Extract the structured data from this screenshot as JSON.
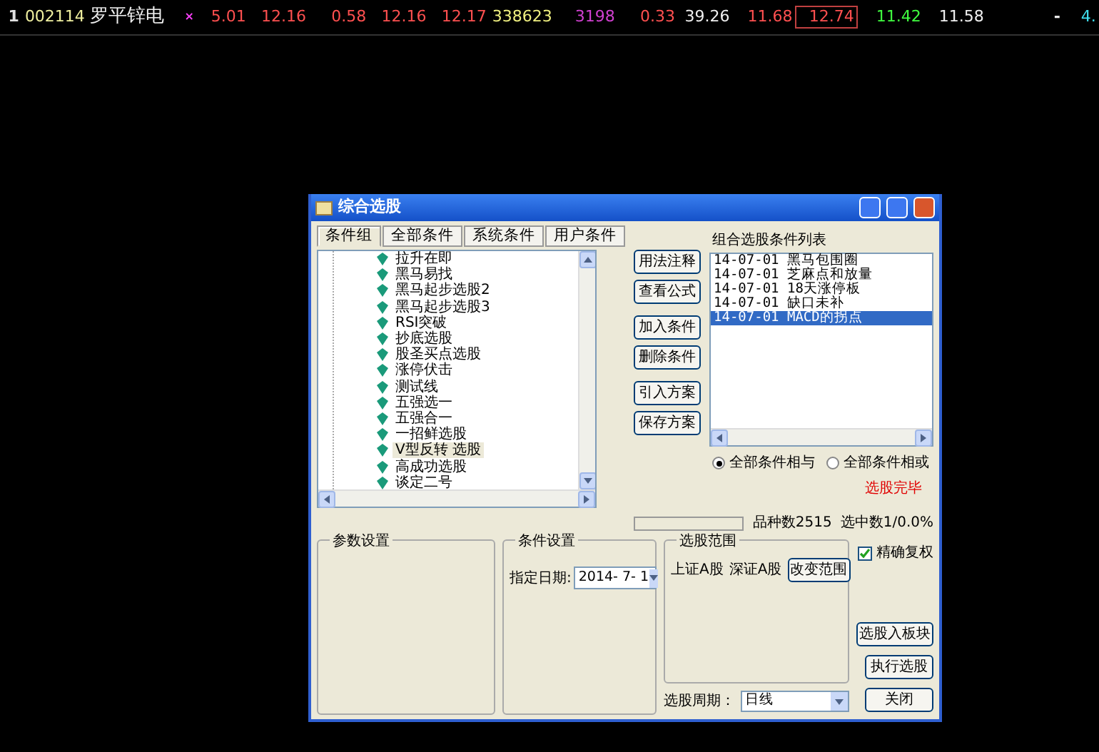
{
  "quote_row": {
    "cells": [
      {
        "text": "1",
        "color": "#e0e0e0"
      },
      {
        "text": "002114",
        "color": "#f0f0a0"
      },
      {
        "text": "罗平锌电",
        "color": "#f0f0f0"
      },
      {
        "text": "×",
        "color": "#ff40ff"
      },
      {
        "text": "5.01",
        "color": "#ff5050"
      },
      {
        "text": "12.16",
        "color": "#ff5050"
      },
      {
        "text": "0.58",
        "color": "#ff5050"
      },
      {
        "text": "12.16",
        "color": "#ff5050"
      },
      {
        "text": "12.17",
        "color": "#ff5050"
      },
      {
        "text": "338623",
        "color": "#f0f080"
      },
      {
        "text": "3198",
        "color": "#d040d0"
      },
      {
        "text": "0.33",
        "color": "#ff5050"
      },
      {
        "text": "39.26",
        "color": "#f0f0f0"
      },
      {
        "text": "11.68",
        "color": "#ff5050"
      },
      {
        "text": "12.74",
        "color": "#ff5050",
        "boxed": true
      },
      {
        "text": "11.42",
        "color": "#40ff40"
      },
      {
        "text": "11.58",
        "color": "#f0f0f0"
      },
      {
        "text": "-",
        "color": "#f0f0f0"
      },
      {
        "text": "4.",
        "color": "#40e0f0"
      }
    ]
  },
  "dialog": {
    "title": "综合选股",
    "tabs": [
      {
        "label": "条件组",
        "selected": true
      },
      {
        "label": "全部条件",
        "selected": false
      },
      {
        "label": "系统条件",
        "selected": false
      },
      {
        "label": "用户条件",
        "selected": false
      }
    ],
    "tree_items": [
      {
        "label": "拉升在即",
        "selected": false
      },
      {
        "label": "黑马易找",
        "selected": false
      },
      {
        "label": "黑马起步选股2",
        "selected": false
      },
      {
        "label": "黑马起步选股3",
        "selected": false
      },
      {
        "label": "RSI突破",
        "selected": false
      },
      {
        "label": "抄底选股",
        "selected": false
      },
      {
        "label": "股圣买点选股",
        "selected": false
      },
      {
        "label": "涨停伏击",
        "selected": false
      },
      {
        "label": "测试线",
        "selected": false
      },
      {
        "label": "五强选一",
        "selected": false
      },
      {
        "label": "五强合一",
        "selected": false
      },
      {
        "label": "一招鲜选股",
        "selected": false
      },
      {
        "label": "V型反转 选股",
        "selected": true
      },
      {
        "label": "高成功选股",
        "selected": false
      },
      {
        "label": "谈定二号",
        "selected": false
      }
    ],
    "middle_buttons": [
      [
        "用法注释",
        "查看公式"
      ],
      [
        "加入条件",
        "删除条件"
      ],
      [
        "引入方案",
        "保存方案"
      ]
    ],
    "list_label": "组合选股条件列表",
    "conditions": [
      {
        "date": "14-07-01",
        "name": "黑马包围圈",
        "selected": false
      },
      {
        "date": "14-07-01",
        "name": "芝麻点和放量",
        "selected": false
      },
      {
        "date": "14-07-01",
        "name": "18天涨停板",
        "selected": false
      },
      {
        "date": "14-07-01",
        "name": "缺口未补",
        "selected": false
      },
      {
        "date": "14-07-01",
        "name": "MACD的拐点",
        "selected": true
      }
    ],
    "logic_options": [
      {
        "label": "全部条件相与",
        "selected": true
      },
      {
        "label": "全部条件相或",
        "selected": false
      }
    ],
    "status": "选股完毕",
    "progress": {
      "level": 0
    },
    "stock_count": "品种数2515",
    "selected_count": "选中数1/0.0%",
    "param_group": {
      "title": "参数设置"
    },
    "condition_group": {
      "title": "条件设置",
      "date_label": "指定日期:",
      "date_value": "2014- 7- 1"
    },
    "range_group": {
      "title": "选股范围",
      "markets": [
        "上证A股",
        "深证A股"
      ],
      "button": "改变范围"
    },
    "period": {
      "label": "选股周期：",
      "value": "日线"
    },
    "precise_adjust": {
      "label": "精确复权",
      "checked": true
    },
    "action_buttons": [
      "选股入板块",
      "执行选股",
      "关闭"
    ]
  }
}
